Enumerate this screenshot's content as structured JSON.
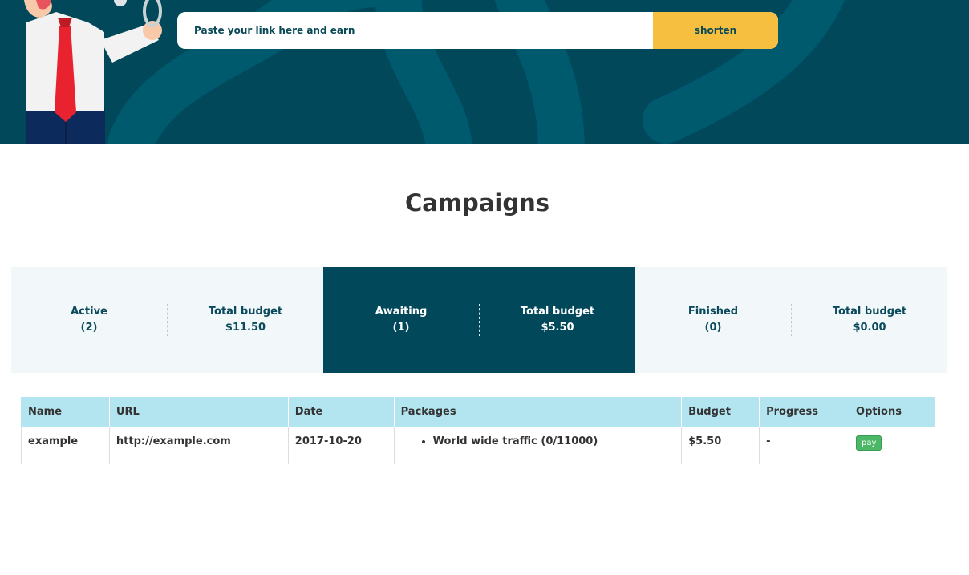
{
  "hero": {
    "input_placeholder": "Paste your link here and earn",
    "shorten_label": "shorten"
  },
  "page_title": "Campaigns",
  "stats": [
    {
      "status_label": "Active",
      "status_count": "(2)",
      "budget_label": "Total budget",
      "budget_value": "$11.50"
    },
    {
      "status_label": "Awaiting",
      "status_count": "(1)",
      "budget_label": "Total budget",
      "budget_value": "$5.50"
    },
    {
      "status_label": "Finished",
      "status_count": "(0)",
      "budget_label": "Total budget",
      "budget_value": "$0.00"
    }
  ],
  "table": {
    "headers": [
      "Name",
      "URL",
      "Date",
      "Packages",
      "Budget",
      "Progress",
      "Options"
    ],
    "rows": [
      {
        "name": "example",
        "url": "http://example.com",
        "date": "2017-10-20",
        "package": "World wide traffic (0/11000)",
        "budget": "$5.50",
        "progress": "-",
        "option": "pay"
      }
    ]
  },
  "colors": {
    "hero_bg": "#00485a",
    "accent": "#f6bf40",
    "table_header": "#b3e5f0",
    "pay_button": "#4cb867"
  }
}
